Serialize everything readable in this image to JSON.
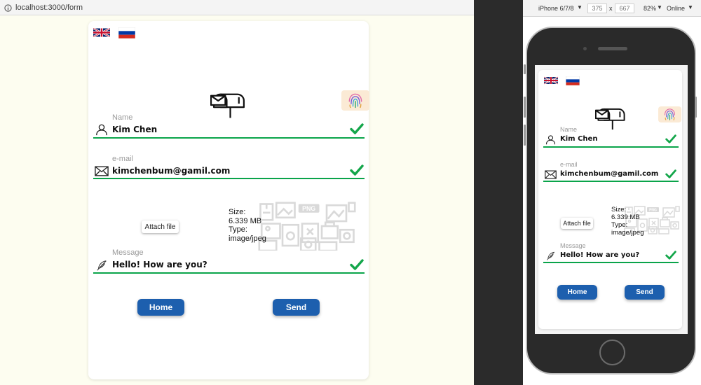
{
  "browser": {
    "url": "localhost:3000/form"
  },
  "devtools": {
    "device": "iPhone 6/7/8",
    "width": "375",
    "separator": "x",
    "height": "667",
    "zoom": "82%",
    "network": "Online"
  },
  "form": {
    "name_label": "Name",
    "name_value": "Kim Chen",
    "email_label": "e-mail",
    "email_value": "kimchenbum@gamil.com",
    "attach_label": "Attach file",
    "file_size_label": "Size:",
    "file_size_value": "6.339 MB",
    "file_type_label": "Type:",
    "file_type_value": "image/jpeg",
    "message_label": "Message",
    "message_value": "Hello! How are you?",
    "home_label": "Home",
    "send_label": "Send"
  },
  "icons": {
    "flag_uk": "uk-flag-icon",
    "flag_ru": "russia-flag-icon",
    "mailbox": "mailbox-icon",
    "fingerprint": "fingerprint-icon",
    "user": "user-icon",
    "email": "envelope-icon",
    "message": "feather-pen-icon",
    "check": "check-icon",
    "file_collage": "image-files-icon"
  },
  "colors": {
    "accent": "#1d5fae",
    "valid": "#0aa44a",
    "page_bg": "#fdfdf0",
    "fingerprint_bg": "#fbead5"
  }
}
